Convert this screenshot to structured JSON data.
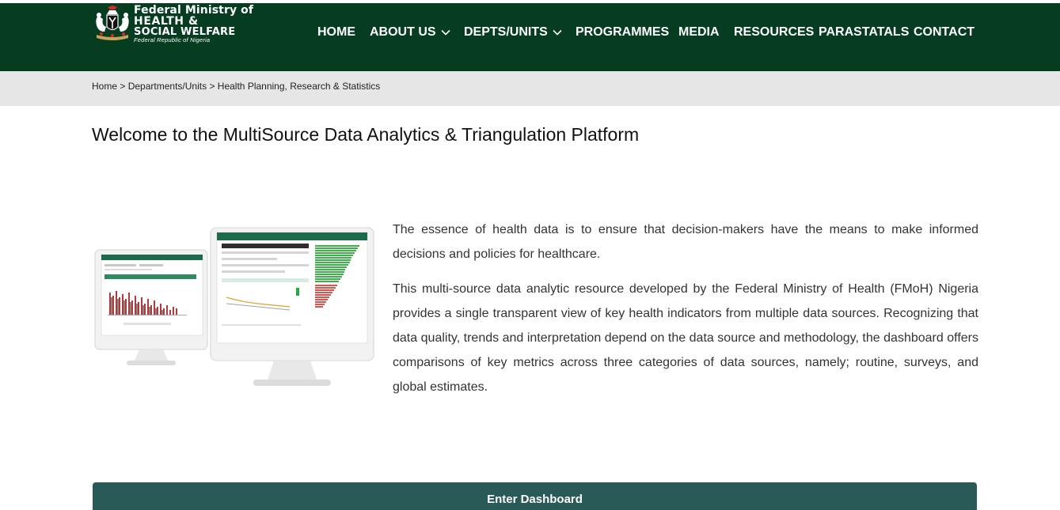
{
  "header": {
    "brand": {
      "line1": "Federal Ministry of",
      "line2": "HEALTH &",
      "line3": "SOCIAL WELFARE",
      "line4": "Federal Republic of Nigeria"
    },
    "nav": [
      {
        "label": "HOME",
        "has_dropdown": false
      },
      {
        "label": "ABOUT US",
        "has_dropdown": true
      },
      {
        "label": "DEPTS/UNITS",
        "has_dropdown": true
      },
      {
        "label": "PROGRAMMES",
        "has_dropdown": false
      },
      {
        "label": "MEDIA",
        "has_dropdown": false
      },
      {
        "label": "RESOURCES",
        "has_dropdown": false
      },
      {
        "label": "PARASTATALS",
        "has_dropdown": false
      },
      {
        "label": "CONTACT",
        "has_dropdown": false
      }
    ],
    "colors": {
      "header_bg": "#063d21",
      "crumb_bg": "#e6e6e6",
      "cta_bg": "#2a5a57"
    }
  },
  "breadcrumb": {
    "home": "Home",
    "sep": ">",
    "section": "Departments/Units",
    "current": "Health Planning, Research & Statistics"
  },
  "main": {
    "title": "Welcome to the MultiSource Data Analytics & Triangulation Platform",
    "paragraph1": "The essence of health data is to ensure that decision-makers have the means to make informed decisions and policies for healthcare.",
    "paragraph2": "This multi-source data analytic resource developed by the Federal Ministry of Health (FMoH) Nigeria provides a single transparent view of key health indicators from multiple data sources. Recognizing that data quality, trends and interpretation depend on the data source and methodology, the dashboard offers comparisons of key metrics across three categories of data sources, namely; routine, surveys, and global estimates.",
    "cta_label": "Enter Dashboard"
  }
}
